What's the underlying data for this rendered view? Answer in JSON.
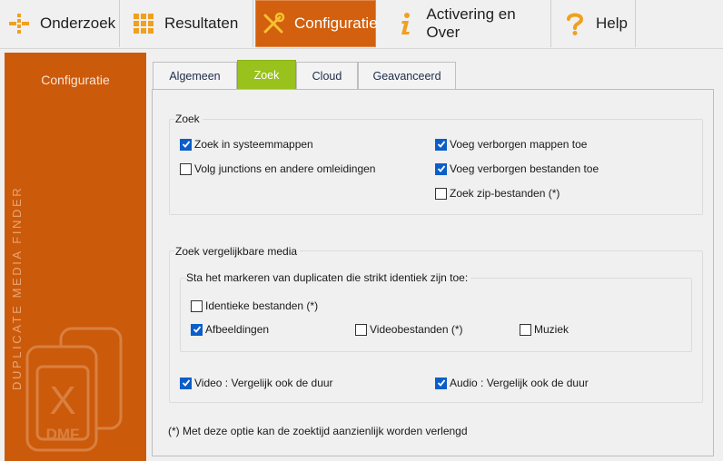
{
  "nav": {
    "items": [
      {
        "label": "Onderzoek",
        "icon": "dots-grid-icon"
      },
      {
        "label": "Resultaten",
        "icon": "squares-grid-icon"
      },
      {
        "label": "Configuratie",
        "icon": "tools-icon",
        "active": true
      },
      {
        "label": "Activering en Over",
        "icon": "info-icon"
      },
      {
        "label": "Help",
        "icon": "question-icon"
      }
    ]
  },
  "sidebar": {
    "title": "Configuratie",
    "brand": "DUPLICATE MEDIA FINDER",
    "logo_text": "DMF",
    "logo_letter": "X"
  },
  "tabs": [
    {
      "label": "Algemeen"
    },
    {
      "label": "Zoek",
      "active": true
    },
    {
      "label": "Cloud"
    },
    {
      "label": "Geavanceerd"
    }
  ],
  "zoek_group": {
    "title": "Zoek",
    "options": [
      {
        "label": "Zoek in systeemmappen",
        "checked": true
      },
      {
        "label": "Volg junctions en andere omleidingen",
        "checked": false
      },
      {
        "label": "Voeg verborgen mappen toe",
        "checked": true
      },
      {
        "label": "Voeg verborgen bestanden toe",
        "checked": true
      },
      {
        "label": "Zoek zip-bestanden (*)",
        "checked": false
      }
    ]
  },
  "media_group": {
    "title": "Zoek vergelijkbare media",
    "subgroup_title": "Sta het markeren van duplicaten die strikt identiek zijn toe:",
    "identical_options": [
      {
        "label": "Identieke bestanden (*)",
        "checked": false
      },
      {
        "label": "Afbeeldingen",
        "checked": true
      },
      {
        "label": "Videobestanden (*)",
        "checked": false
      },
      {
        "label": "Muziek",
        "checked": false
      }
    ],
    "duration_options": [
      {
        "label": "Video : Vergelijk ook de duur",
        "checked": true
      },
      {
        "label": "Audio : Vergelijk ook de duur",
        "checked": true
      }
    ]
  },
  "footnote": "(*)  Met deze optie kan de zoektijd aanzienlijk worden verlengd",
  "colors": {
    "accent_orange": "#cc5a0b",
    "tab_green": "#99c21c",
    "check_blue": "#0b5ec8"
  }
}
